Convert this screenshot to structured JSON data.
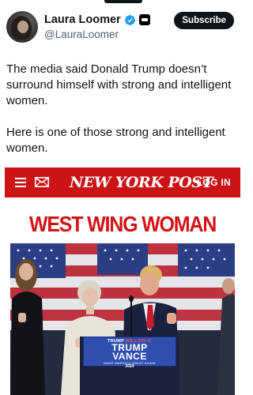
{
  "tweet": {
    "author": {
      "display_name": "Laura Loomer",
      "handle": "@LauraLoomer"
    },
    "subscribe_label": "Subscribe",
    "paragraphs": [
      "The media said Donald Trump doesn’t surround himself with strong and intelligent women.",
      "Here is one of those strong and intelligent women."
    ]
  },
  "media": {
    "nyp_header": {
      "masthead": "NEW YORK POST",
      "login_label": "LOG IN"
    },
    "headline": "WEST WING WOMAN",
    "photo": {
      "podium_sign": {
        "top_line_prefix": "TRUMP",
        "top_line_highlight": "WILL FIX IT",
        "main_line_1": "TRUMP",
        "main_line_2": "VANCE",
        "sub_line": "MAKE AMERICA GREAT AGAIN",
        "year": "2024"
      }
    }
  },
  "colors": {
    "nyp_red": "#cc1417",
    "headline_red": "#d41418",
    "verified_blue": "#1d9bf0",
    "handle_gray": "#536471"
  },
  "icons": [
    "verified-badge-icon",
    "affiliation-badge-icon",
    "menu-icon",
    "mail-icon"
  ]
}
